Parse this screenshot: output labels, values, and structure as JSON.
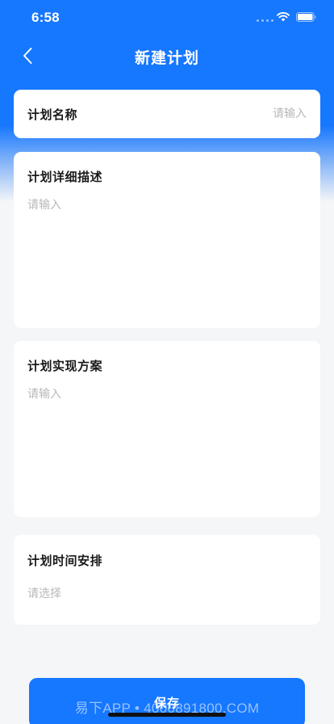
{
  "status_bar": {
    "time": "6:58",
    "icons": [
      "signal-dots-icon",
      "wifi-icon",
      "battery-icon"
    ]
  },
  "nav": {
    "back_icon": "chevron-left-icon",
    "title": "新建计划"
  },
  "form": {
    "plan_name": {
      "label": "计划名称",
      "value": "",
      "placeholder": "请输入"
    },
    "plan_description": {
      "label": "计划详细描述",
      "value": "",
      "placeholder": "请输入"
    },
    "plan_solution": {
      "label": "计划实现方案",
      "value": "",
      "placeholder": "请输入"
    },
    "plan_schedule": {
      "label": "计划时间安排",
      "placeholder": "请选择"
    }
  },
  "actions": {
    "save_label": "保存"
  },
  "watermark": "易下APP • 4000891800.COM",
  "colors": {
    "primary": "#1677ff",
    "page_bg": "#f5f6f8",
    "placeholder": "#b8b8b8",
    "label": "#1a1a1a"
  }
}
